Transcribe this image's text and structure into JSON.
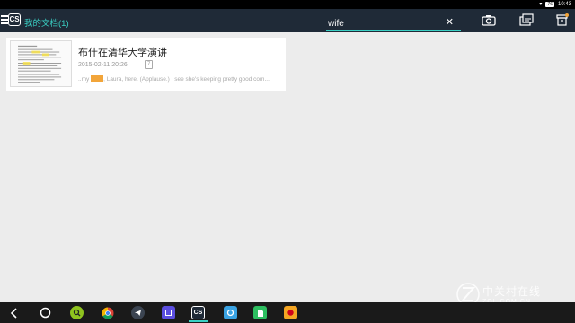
{
  "status_bar": {
    "battery": "76",
    "time": "10:43"
  },
  "app_bar": {
    "logo_text": "CS",
    "title": "我的文档(1)"
  },
  "search": {
    "value": "wife"
  },
  "document": {
    "title": "布什在清华大学演讲",
    "date": "2015-02-11 20:26",
    "badge": "7",
    "snippet_prefix": "..my",
    "snippet_rest": ", Laura, here. (Applause.) I see she's keeping pretty good com..."
  },
  "taskbar": {
    "cs_label": "CS"
  },
  "watermark": {
    "cn": "中关村在线",
    "en": "ZOL.COM.CN"
  },
  "colors": {
    "accent": "#3ad0c4",
    "app_bar": "#1f2a37",
    "highlight": "#f2a53a"
  }
}
